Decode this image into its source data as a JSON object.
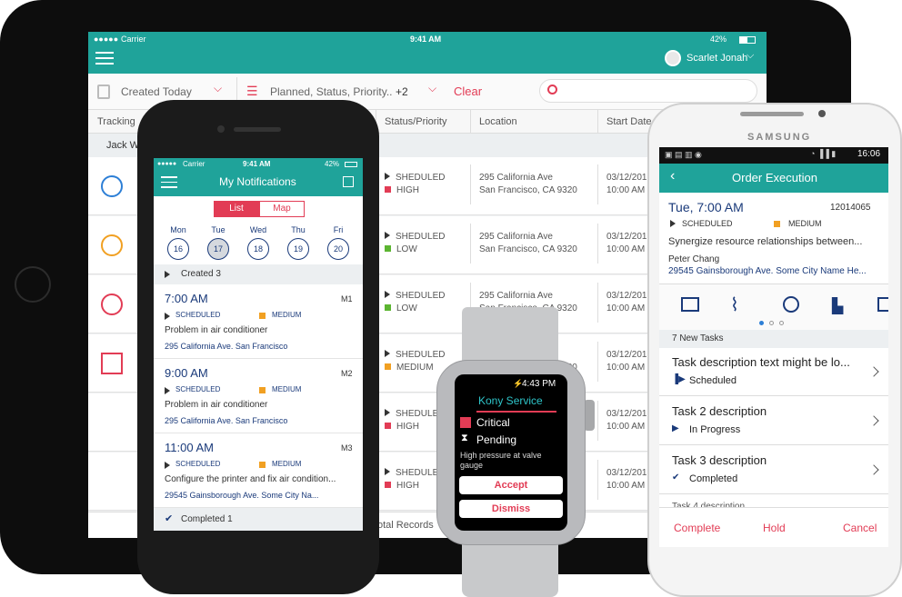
{
  "ipad": {
    "status": {
      "carrier": "Carrier",
      "time": "9:41 AM",
      "battery": "42%"
    },
    "user_name": "Scarlet Jonah",
    "filter": {
      "created": "Created Today",
      "status_filter": "Planned, Status, Priority..",
      "extra_count": "+2",
      "clear": "Clear"
    },
    "columns": {
      "tracking": "Tracking",
      "status_priority": "Status/Priority",
      "location": "Location",
      "start_date": "Start Date"
    },
    "group_label": "Jack W",
    "rows": [
      {
        "status": "SHEDULED",
        "priority": "HIGH",
        "priority_color": "#e23c55",
        "addr1": "295 California Ave",
        "addr2": "San Francisco, CA 9320",
        "date": "03/12/201",
        "time": "10:00 AM",
        "icon": "clock-icon",
        "icon_color": "#2d7fd6"
      },
      {
        "status": "SHEDULED",
        "priority": "LOW",
        "priority_color": "#5cb531",
        "addr1": "295 California Ave",
        "addr2": "San Francisco, CA 9320",
        "date": "03/12/201",
        "time": "10:00 AM",
        "icon": "timer-icon",
        "icon_color": "#f1a022"
      },
      {
        "status": "SHEDULED",
        "priority": "LOW",
        "priority_color": "#5cb531",
        "addr1": "295 California Ave",
        "addr2": "San Francisco, CA 9320",
        "date": "03/12/201",
        "time": "10:00 AM",
        "icon": "fast-clock-icon",
        "icon_color": "#e23c55"
      },
      {
        "status": "SHEDULED",
        "priority": "MEDIUM",
        "priority_color": "#f1a022",
        "addr1": "295 California Ave",
        "addr2": "San Francisco, CA 9320",
        "date": "03/12/201",
        "time": "10:00 AM",
        "icon": "alert-clock-icon",
        "icon_color": "#e23c55"
      },
      {
        "status": "SHEDULED",
        "priority": "HIGH",
        "priority_color": "#e23c55",
        "addr1": "295 California Ave",
        "addr2": "San Francisco, CA 9320",
        "date": "03/12/201",
        "time": "10:00 AM",
        "icon": "",
        "icon_color": ""
      },
      {
        "status": "SHEDULED",
        "priority": "HIGH",
        "priority_color": "#e23c55",
        "addr1": "295 California Ave",
        "addr2": "San Francisco, CA 9320",
        "date": "03/12/201",
        "time": "10:00 AM",
        "icon": "",
        "icon_color": ""
      }
    ],
    "footer": "otal Records"
  },
  "iphone": {
    "status": {
      "carrier": "Carrier",
      "time": "9:41 AM",
      "battery": "42%"
    },
    "title": "My Notifications",
    "seg": {
      "list": "List",
      "map": "Map"
    },
    "days": [
      {
        "name": "Mon",
        "num": "16"
      },
      {
        "name": "Tue",
        "num": "17"
      },
      {
        "name": "Wed",
        "num": "18"
      },
      {
        "name": "Thu",
        "num": "19"
      },
      {
        "name": "Fri",
        "num": "20"
      }
    ],
    "created_header": "Created 3",
    "items": [
      {
        "time": "7:00 AM",
        "code": "M1",
        "status": "SCHEDULED",
        "priority": "MEDIUM",
        "desc": "Problem in air conditioner",
        "addr": "295 California Ave. San Francisco"
      },
      {
        "time": "9:00 AM",
        "code": "M2",
        "status": "SCHEDULED",
        "priority": "MEDIUM",
        "desc": "Problem in air conditioner",
        "addr": "295 California Ave. San Francisco"
      },
      {
        "time": "11:00 AM",
        "code": "M3",
        "status": "SCHEDULED",
        "priority": "MEDIUM",
        "desc": "Configure the printer and fix air condition...",
        "addr": "29545 Gainsborough Ave. Some City Na..."
      }
    ],
    "completed": "Completed 1"
  },
  "watch": {
    "time": "4:43 PM",
    "title": "Kony Service",
    "severity": "Critical",
    "state": "Pending",
    "message": "High pressure at valve gauge",
    "accept": "Accept",
    "dismiss": "Dismiss"
  },
  "samsung": {
    "brand": "SAMSUNG",
    "status_time": "16:06",
    "title": "Order Execution",
    "order_time": "Tue, 7:00 AM",
    "order_id": "12014065",
    "status": "SCHEDULED",
    "priority": "MEDIUM",
    "description": "Synergize resource relationships between...",
    "customer": "Peter Chang",
    "address": "29545 Gainsborough Ave. Some City Name He...",
    "tasks_header": "7 New Tasks",
    "tasks": [
      {
        "title": "Task description text might be lo...",
        "state": "Scheduled"
      },
      {
        "title": "Task 2 description",
        "state": "In Progress"
      },
      {
        "title": "Task 3 description",
        "state": "Completed"
      }
    ],
    "next_task_partial": "Task 4 description",
    "actions": {
      "complete": "Complete",
      "hold": "Hold",
      "cancel": "Cancel"
    }
  },
  "colors": {
    "teal": "#1fa39a",
    "red": "#e23c55",
    "orange": "#f1a022",
    "green": "#5cb531",
    "blue": "#2d7fd6",
    "navy": "#1a3a7a"
  }
}
